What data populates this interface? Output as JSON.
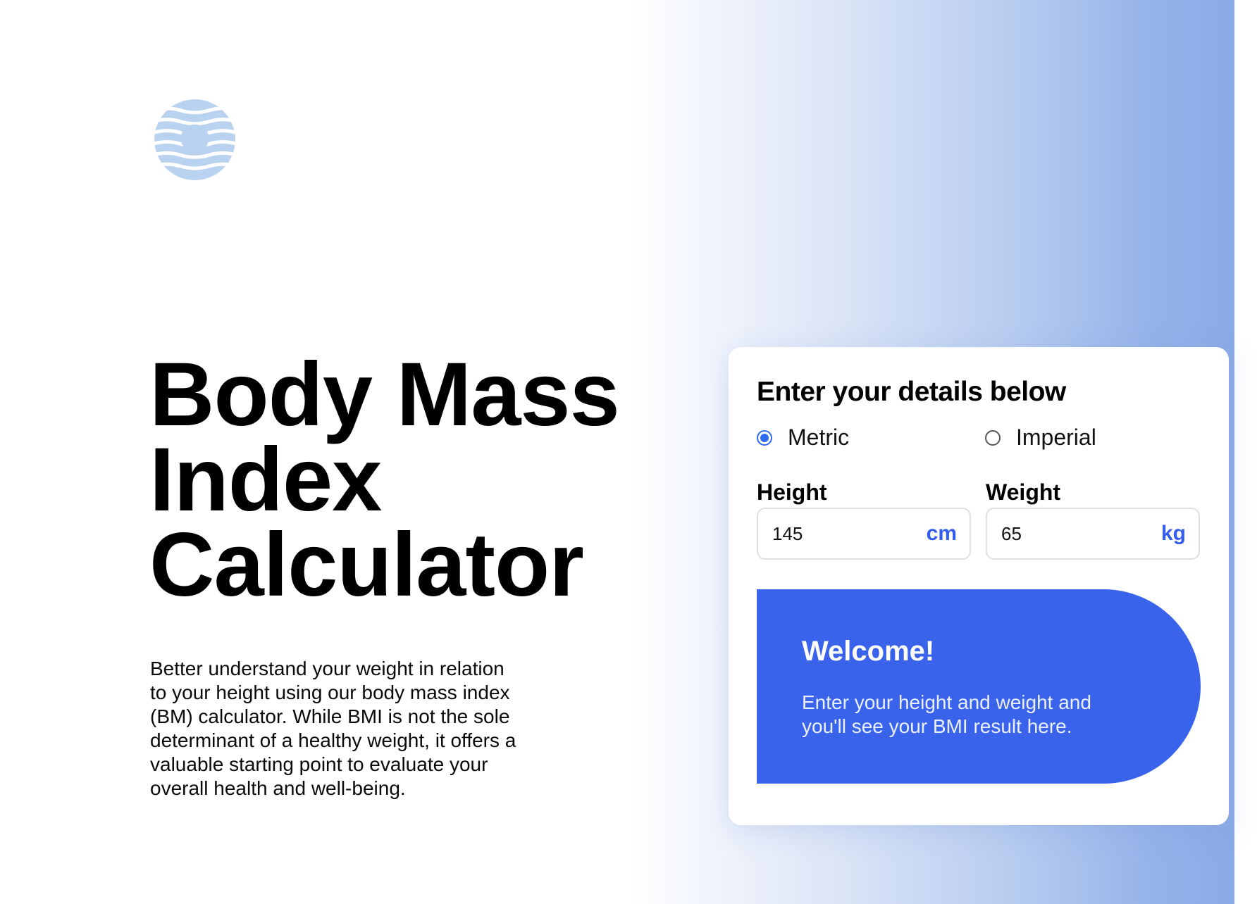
{
  "logo": {
    "icon": "bmi-logo-icon",
    "color": "#b8d2f0"
  },
  "hero": {
    "title_lines": [
      "Body Mass",
      "Index",
      "Calculator"
    ],
    "description": "Better understand your weight in relation to your height using our body mass index (BM) calculator. While BMI is not the sole determinant of a healthy weight, it offers a valuable starting point to evaluate your overall health and well-being."
  },
  "calculator": {
    "title": "Enter your details below",
    "units": {
      "metric_label": "Metric",
      "imperial_label": "Imperial",
      "selected": "Metric"
    },
    "height": {
      "label": "Height",
      "value": "145",
      "unit": "cm"
    },
    "weight": {
      "label": "Weight",
      "value": "65",
      "unit": "kg"
    },
    "result": {
      "title": "Welcome!",
      "message": "Enter your height and weight and you'll see your BMI result here."
    }
  },
  "colors": {
    "accent": "#3a63ec",
    "unit_text": "#345df0",
    "radio_selected": "#2e6bf0",
    "gradient_end": "#89a9e6"
  }
}
